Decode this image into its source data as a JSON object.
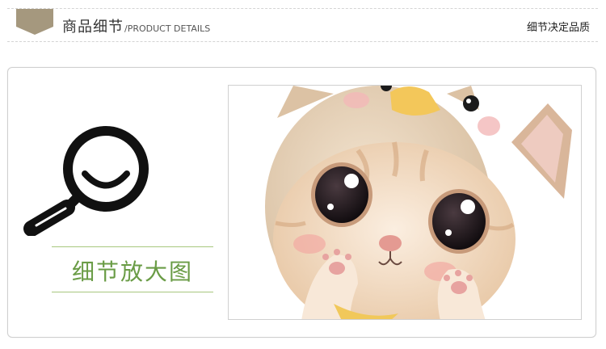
{
  "header": {
    "title_cn": "商品细节",
    "title_en": "/PRODUCT DETAILS",
    "slogan": "细节决定品质"
  },
  "detail": {
    "zoom_label": "细节放大图"
  },
  "colors": {
    "tag": "#a5987e",
    "accent_green": "#6a9c46",
    "divider_green": "#a7c77e",
    "panel_border": "#cfcfcf"
  },
  "icons": {
    "header_tag": "pennant-tag-icon",
    "zoom": "magnifier-icon"
  }
}
